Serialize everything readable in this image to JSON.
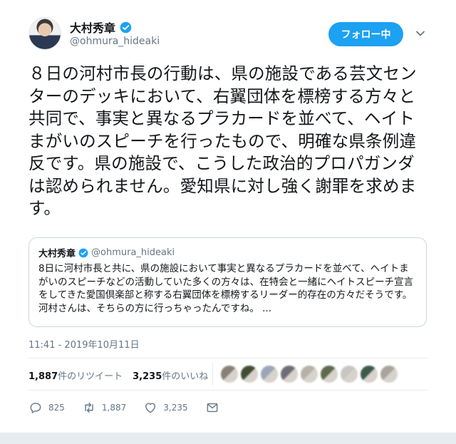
{
  "author": {
    "name": "大村秀章",
    "handle": "@ohmura_hideaki",
    "verified": true
  },
  "follow_button": {
    "label": "フォロー中"
  },
  "tweet": {
    "text": "８日の河村市長の行動は、県の施設である芸文センターのデッキにおいて、右翼団体を標榜する方々と共同で、事実と異なるプラカードを並べて、ヘイトまがいのスピーチを行ったもので、明確な県条例違反です。県の施設で、こうした政治的プロパガンダは認められません。愛知県に対し強く謝罪を求めます。"
  },
  "quoted_tweet": {
    "name": "大村秀章",
    "handle": "@ohmura_hideaki",
    "text": "8日に河村市長と共に、県の施設において事実と異なるプラカードを並べて、ヘイトまがいのスピーチなどの活動していた多くの方々は、在特会と一緒にヘイトスピーチ宣言をしてきた愛国倶楽部と称する右翼団体を標榜するリーダー的存在の方々だそうです。河村さんは、そちらの方に行っちゃったんですね。 ..."
  },
  "timestamp": "11:41 - 2019年10月11日",
  "stats": {
    "retweets_count": "1,887",
    "retweets_label": "件のリツイート",
    "likes_count": "3,235",
    "likes_label": "件のいいね"
  },
  "likers": [
    "#8a7f76",
    "#3f4d33",
    "#9aa7b8",
    "#6e6e78",
    "#b6b2a8",
    "#5c6b4a",
    "#c8c6c2",
    "#3b5a4a",
    "#a9a39c"
  ],
  "actions": {
    "reply_count": "825",
    "retweet_count": "1,887",
    "like_count": "3,235"
  },
  "colors": {
    "accent": "#1da1f2",
    "secondary_text": "#657786",
    "border": "#ccd6dd"
  },
  "icons": {
    "verified": "verified-badge-icon",
    "caret": "chevron-down-icon",
    "reply": "reply-icon",
    "retweet": "retweet-icon",
    "like": "heart-icon",
    "dm": "envelope-icon"
  }
}
